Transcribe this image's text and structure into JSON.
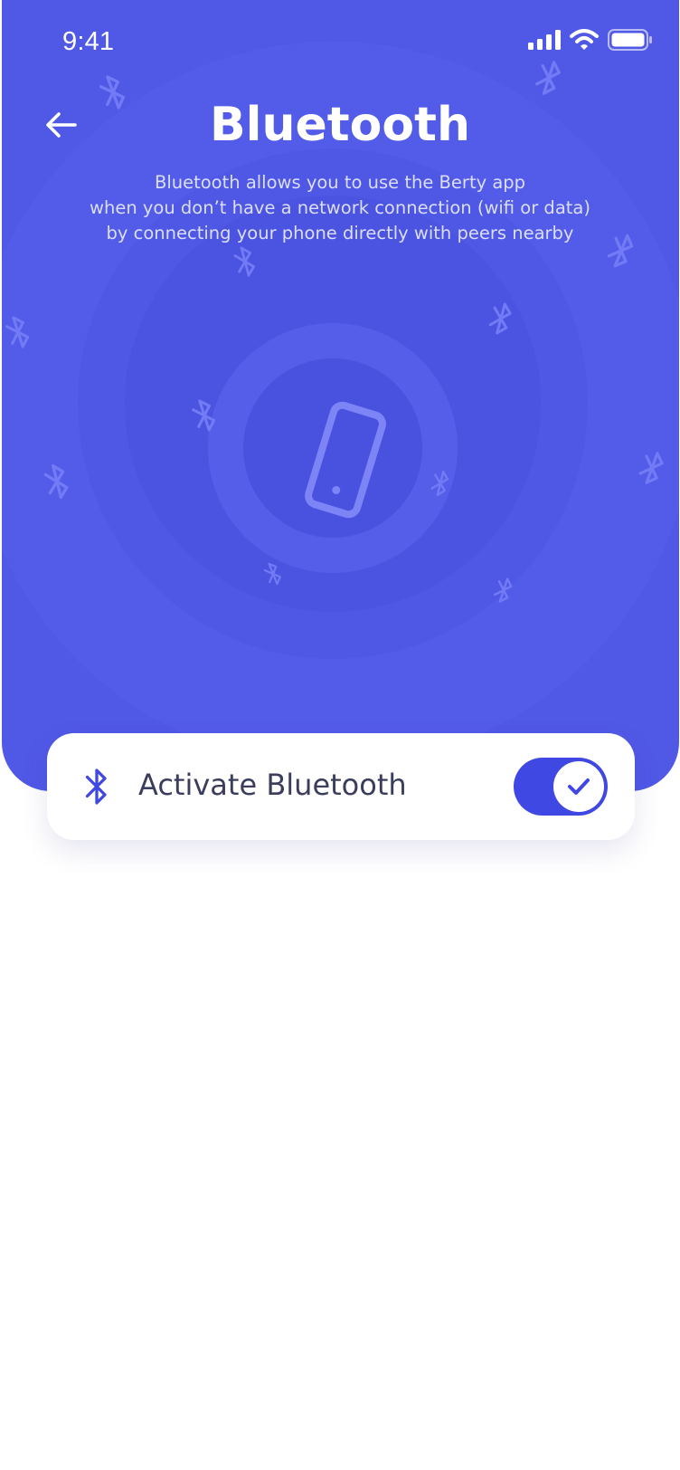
{
  "status_bar": {
    "time": "9:41"
  },
  "header": {
    "title": "Bluetooth",
    "description_lines": [
      "Bluetooth allows you to use the Berty app",
      "when you don’t have a network connection (wifi or data)",
      "by connecting your phone directly with peers nearby"
    ]
  },
  "bluetooth_toggle": {
    "label": "Activate Bluetooth",
    "state": "on"
  },
  "colors": {
    "primary": "#5058e6",
    "accent": "#4048e3",
    "text_dark": "#3a3d5c",
    "background": "#ffffff"
  },
  "icons": {
    "back": "arrow-left-icon",
    "phone": "smartphone-icon",
    "bluetooth": "bluetooth-icon",
    "check": "check-icon"
  }
}
